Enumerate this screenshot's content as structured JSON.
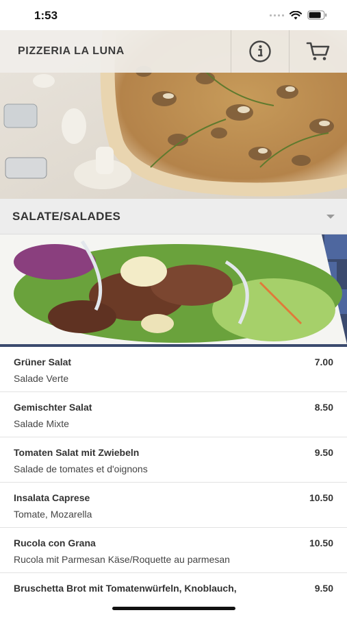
{
  "status": {
    "time": "1:53"
  },
  "header": {
    "title": "PIZZERIA LA LUNA",
    "info_icon": "info-icon",
    "cart_icon": "cart-icon"
  },
  "section": {
    "title": "SALATE/SALADES",
    "chevron_icon": "chevron-down-icon"
  },
  "items": [
    {
      "name": "Grüner Salat",
      "desc": "Salade Verte",
      "price": "7.00"
    },
    {
      "name": "Gemischter Salat",
      "desc": "Salade Mixte",
      "price": "8.50"
    },
    {
      "name": "Tomaten Salat mit Zwiebeln",
      "desc": "Salade de tomates et d'oignons",
      "price": "9.50"
    },
    {
      "name": "Insalata Caprese",
      "desc": "Tomate, Mozarella",
      "price": "10.50"
    },
    {
      "name": "Rucola con Grana",
      "desc": "Rucola mit Parmesan Käse/Roquette au parmesan",
      "price": "10.50"
    },
    {
      "name": "Bruschetta Brot mit Tomatenwürfeln, Knoblauch,",
      "desc": "",
      "price": "9.50"
    }
  ],
  "colors": {
    "header_bg": "#f0eeea",
    "section_bg": "#ededed",
    "text": "#333333"
  }
}
